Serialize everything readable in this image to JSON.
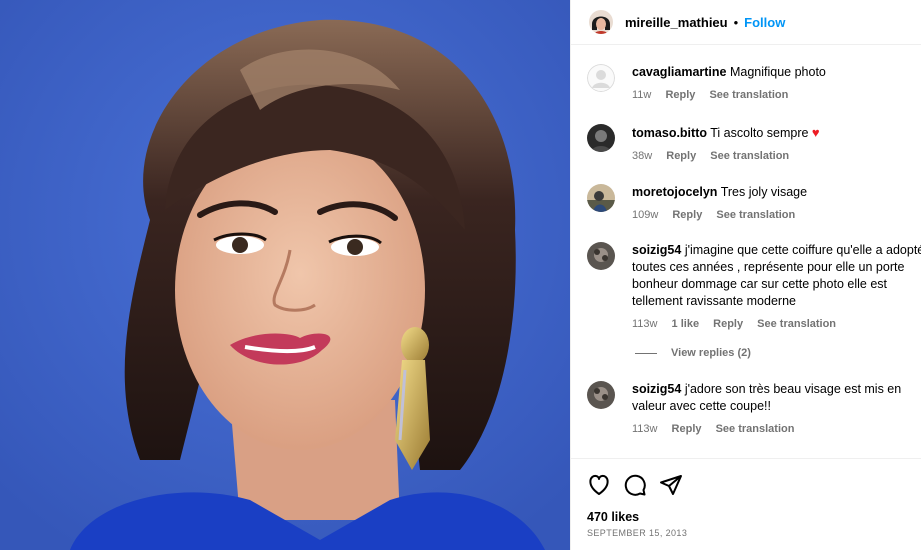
{
  "post": {
    "username": "mireille_mathieu",
    "separator": "•",
    "follow_label": "Follow"
  },
  "comments": [
    {
      "user": "cavagliamartine",
      "text": "Magnifique photo",
      "time": "11w",
      "likes": "",
      "reply": "Reply",
      "translate": "See translation",
      "avatar": "default-avatar-icon"
    },
    {
      "user": "tomaso.bitto",
      "text": "Ti ascolto sempre",
      "emoji": "♥",
      "time": "38w",
      "likes": "",
      "reply": "Reply",
      "translate": "See translation",
      "avatar": "user-photo"
    },
    {
      "user": "moretojocelyn",
      "text": "Tres joly visage",
      "time": "109w",
      "likes": "",
      "reply": "Reply",
      "translate": "See translation",
      "avatar": "user-photo"
    },
    {
      "user": "soizig54",
      "text": "j'imagine que cette coiffure qu'elle a adoptée toutes ces années , représente pour elle un porte bonheur dommage car sur cette photo elle est tellement ravissante moderne",
      "time": "113w",
      "likes": "1 like",
      "reply": "Reply",
      "translate": "See translation",
      "avatar": "user-photo"
    },
    {
      "user": "soizig54",
      "text": "j'adore son très beau visage est mis en valeur avec cette coupe!!",
      "time": "113w",
      "likes": "",
      "reply": "Reply",
      "translate": "See translation",
      "avatar": "user-photo"
    }
  ],
  "view_replies": "View replies (2)",
  "actions": {
    "likes": "470 likes",
    "date": "SEPTEMBER 15, 2013"
  },
  "colors": {
    "link": "#0095f6",
    "muted": "#737373",
    "heart": "#ed1c24",
    "photo_bg": "#3f63c9"
  }
}
